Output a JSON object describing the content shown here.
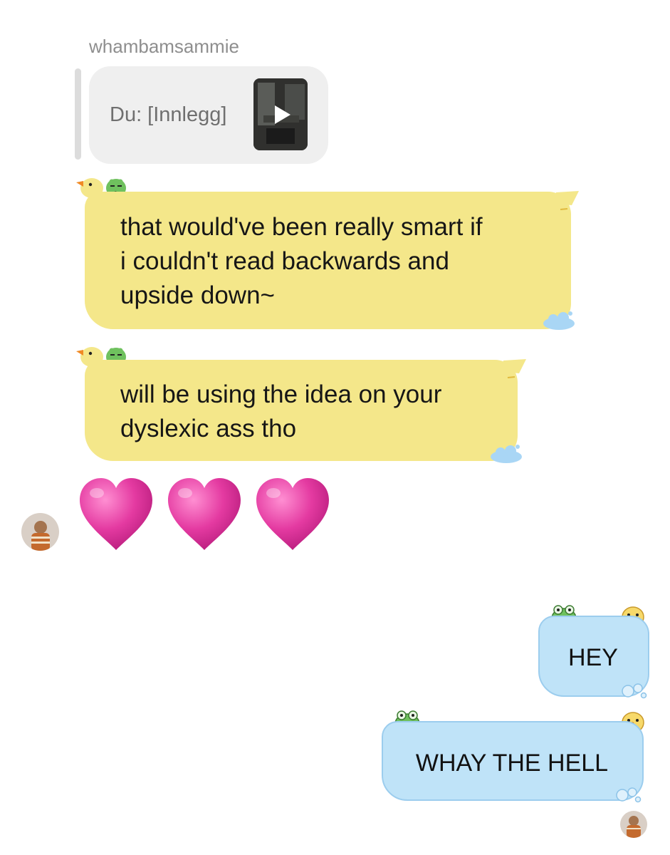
{
  "thread": {
    "sender_name": "whambamsammie",
    "reply_preview": {
      "label": "Du: [Innlegg]",
      "thumbnail_icon": "video-thumbnail-with-play-icon"
    }
  },
  "messages": [
    {
      "from": "them",
      "text": "that would've been really smart if\ni couldn't read backwards and\nupside down~",
      "theme": "duck-frog-sticker-bubble"
    },
    {
      "from": "them",
      "text": "will be using the idea on your\ndyslexic ass tho",
      "theme": "duck-frog-sticker-bubble"
    },
    {
      "from": "them",
      "text": "💗💗💗",
      "type": "emoji",
      "icon": "pink-heart-icon",
      "count": 3
    },
    {
      "from": "me",
      "text": "HEY",
      "theme": "frog-chick-bath-bubble"
    },
    {
      "from": "me",
      "text": "WHAY THE HELL",
      "theme": "frog-chick-bath-bubble"
    }
  ],
  "colors": {
    "yellow_bubble": "#f4e78a",
    "blue_bubble": "#bfe3f8",
    "blue_border": "#9ccdee",
    "quote_bg": "#efefef",
    "heart_pink": "#e6399f"
  }
}
